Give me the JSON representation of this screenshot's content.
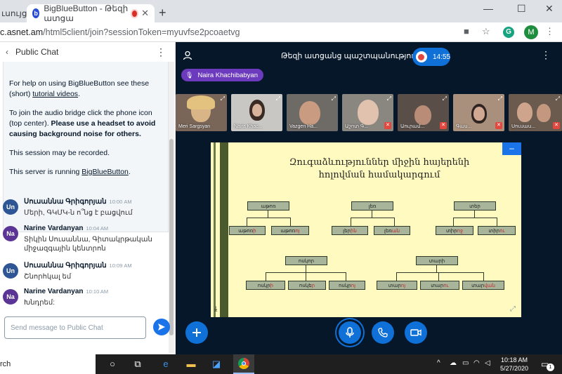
{
  "browser": {
    "tabs": [
      {
        "label": "ւսույց"
      },
      {
        "label": "BigBlueButton - Թեզի ատցա"
      }
    ],
    "url_prefix": "c.asnet.am",
    "url_rest": "/html5client/join?sessionToken=myuvfse2pcoaetvg",
    "profile_initial": "M",
    "grammarly_initial": "G"
  },
  "chat": {
    "header": "Public Chat",
    "welcome": {
      "p1_a": "For help on using BigBlueButton see these (short) ",
      "p1_link": "tutorial videos",
      "p1_b": ".",
      "p2_a": "To join the audio bridge click the phone icon (top center). ",
      "p2_bold": "Please use a headset to avoid causing background noise for others.",
      "p3": "This session may be recorded.",
      "p4_a": "This server is running ",
      "p4_link": "BigBlueButton",
      "p4_b": "."
    },
    "messages": [
      {
        "initials": "Un",
        "name": "Սուսաննա Գրիգորյան",
        "time": "10:00 AM",
        "text": "Մերի, ԳԿՄԿ-ն ո՞նց է բացվում"
      },
      {
        "initials": "Na",
        "name": "Narine Vardanyan",
        "time": "10:04 AM",
        "text": "Տիկին Սուսաննա, Գիտակրթական միջազգային կենտրոն"
      },
      {
        "initials": "Un",
        "name": "Սուսաննա Գրիգորյան",
        "time": "10:09 AM",
        "text": "Շնորհկալ եմ"
      },
      {
        "initials": "Na",
        "name": "Narine Vardanyan",
        "time": "10:10 AM",
        "text": "Խնդրեմ:"
      }
    ],
    "composer_placeholder": "Send message to Public Chat"
  },
  "session": {
    "title": "Թեզի ատցանց պաշտպանություն",
    "rec_time": "14:55",
    "talking": "Naira Khachibabyan",
    "webcams": [
      {
        "name": "Meri Sargsyan",
        "muted": false
      },
      {
        "name": "Naira Khac...",
        "muted": false
      },
      {
        "name": "Vazgen Ha...",
        "muted": false
      },
      {
        "name": "Աշոտ Գ...",
        "muted": true
      },
      {
        "name": "Աուրամ...",
        "muted": true
      },
      {
        "name": "Գաս...",
        "muted": true
      },
      {
        "name": "Սուսաս...",
        "muted": true
      }
    ]
  },
  "slide": {
    "title_line1": "Զուգաձևություններ   միջին հայերենի",
    "title_line2": "հոլովման   համակարգում",
    "groups": [
      {
        "head": "աթոռ",
        "left_a": "աթոռ",
        "left_b": "ի",
        "right_a": "աթոռ",
        "right_b": "ոյ"
      },
      {
        "head": "լեռ",
        "left_a": "լեր",
        "left_b": "ին",
        "right_a": "լեռ",
        "right_b": "ան"
      },
      {
        "head": "տեր",
        "left_a": "տիր",
        "left_b": "ոջ",
        "right_a": "տիր",
        "right_b": "ու"
      },
      {
        "head": "ոսկոր",
        "c1a": "ոսկր",
        "c1b": "ի",
        "c2a": "ոսկե",
        "c2b": "ր",
        "c3a": "ոսկր",
        "c3b": "ոյ"
      },
      {
        "head": "տարի",
        "c1a": "տար",
        "c1b": "ոյ",
        "c2a": "տար",
        "c2b": "ու",
        "c3a": "տար",
        "c3b": "վան"
      }
    ]
  },
  "taskbar": {
    "search": "rch",
    "time": "10:18 AM",
    "date": "5/27/2020",
    "notifications": "1"
  },
  "colors": {
    "accent": "#0f70d7",
    "talker": "#6c3bbd",
    "background": "#06172a"
  }
}
